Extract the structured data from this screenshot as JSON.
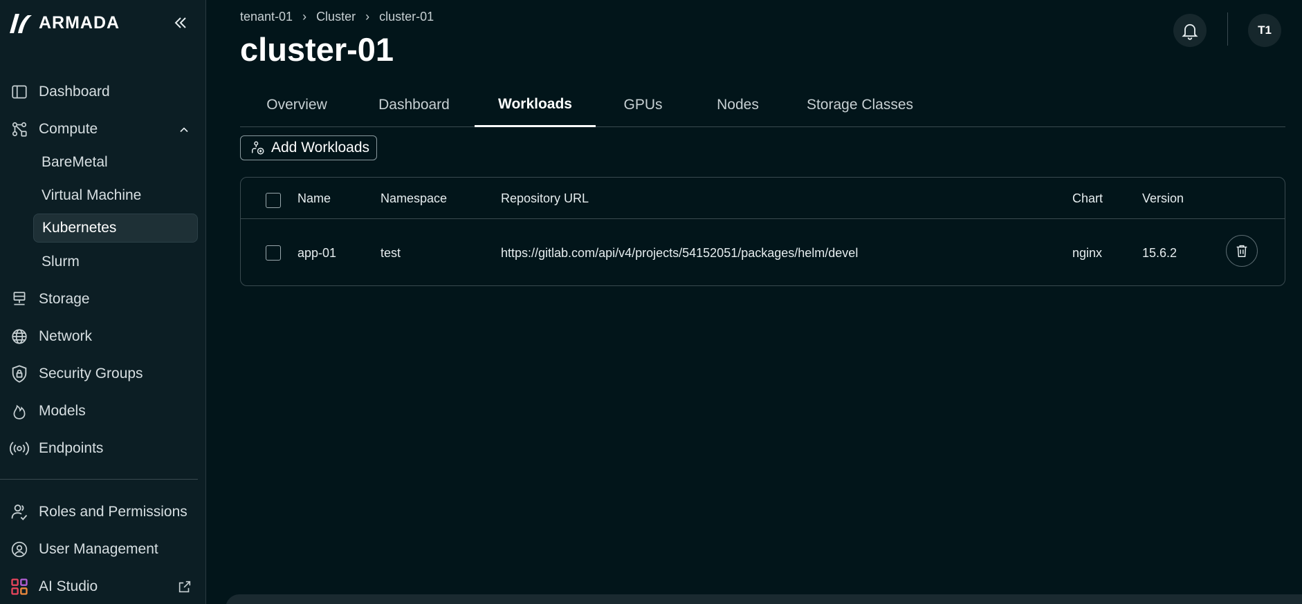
{
  "app": {
    "logo_text": "ARMADA"
  },
  "sidebar": {
    "items": [
      {
        "label": "Dashboard",
        "icon": "sidebar-panel-icon"
      },
      {
        "label": "Compute",
        "icon": "compute-nodes-icon"
      },
      {
        "label": "Storage",
        "icon": "storage-icon"
      },
      {
        "label": "Network",
        "icon": "globe-icon"
      },
      {
        "label": "Security Groups",
        "icon": "shield-lock-icon"
      },
      {
        "label": "Models",
        "icon": "flame-icon"
      },
      {
        "label": "Endpoints",
        "icon": "broadcast-icon"
      }
    ],
    "compute_children": [
      {
        "label": "BareMetal"
      },
      {
        "label": "Virtual Machine"
      },
      {
        "label": "Kubernetes"
      },
      {
        "label": "Slurm"
      }
    ],
    "bottom_items": [
      {
        "label": "Roles and Permissions",
        "icon": "users-check-icon"
      },
      {
        "label": "User Management",
        "icon": "user-circle-icon"
      },
      {
        "label": "AI Studio",
        "icon": "grid-apps-icon"
      }
    ]
  },
  "breadcrumb": [
    "tenant-01",
    "Cluster",
    "cluster-01"
  ],
  "page_title": "cluster-01",
  "avatar_initials": "T1",
  "tabs": [
    {
      "label": "Overview"
    },
    {
      "label": "Dashboard"
    },
    {
      "label": "Workloads"
    },
    {
      "label": "GPUs"
    },
    {
      "label": "Nodes"
    },
    {
      "label": "Storage Classes"
    }
  ],
  "active_tab": "Workloads",
  "add_button_label": "Add Workloads",
  "table": {
    "columns": [
      "Name",
      "Namespace",
      "Repository URL",
      "Chart",
      "Version"
    ],
    "rows": [
      {
        "name": "app-01",
        "namespace": "test",
        "repository_url": "https://gitlab.com/api/v4/projects/54152051/packages/helm/devel",
        "chart": "nginx",
        "version": "15.6.2"
      }
    ]
  },
  "colors": {
    "background": "#02151a",
    "sidebar_bg": "#0c1e24",
    "active_item_bg": "#1e3036",
    "border": "#3a4a50"
  }
}
